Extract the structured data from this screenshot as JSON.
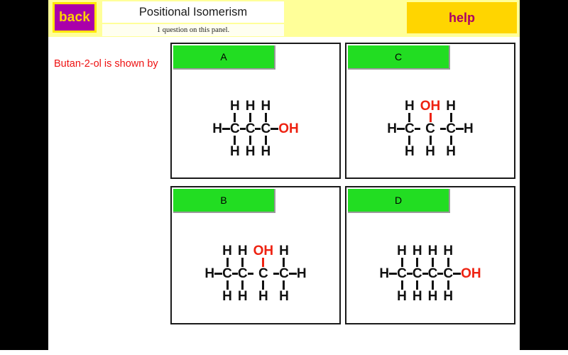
{
  "header": {
    "back_label": "back",
    "title": "Positional Isomerism",
    "subtitle": "1 question on this panel.",
    "help_label": "help",
    "strip_color": "#ffff99",
    "back_color": "#aa00aa",
    "help_color": "#ffd500"
  },
  "question": {
    "prompt": "Butan-2-ol is shown by",
    "prompt_color": "#ee1111"
  },
  "options": [
    {
      "id": "A",
      "label": "A",
      "label_color": "#22dd22",
      "structure": {
        "name": "propan-1-ol",
        "left_terminal": "H",
        "carbons": 3,
        "top_atoms": [
          "H",
          "H",
          "H"
        ],
        "bottom_atoms": [
          "H",
          "H",
          "H"
        ],
        "right_terminal": "OH",
        "right_terminal_color": "#ee2211",
        "hydroxyl_position": "right-terminal"
      }
    },
    {
      "id": "C",
      "label": "C",
      "label_color": "#22dd22",
      "structure": {
        "name": "propan-2-ol",
        "left_terminal": "H",
        "carbons": 3,
        "top_atoms": [
          "H",
          "OH",
          "H"
        ],
        "bottom_atoms": [
          "H",
          "H",
          "H"
        ],
        "right_terminal": "H",
        "right_terminal_color": "#111111",
        "hydroxyl_position": "carbon-2-top"
      }
    },
    {
      "id": "B",
      "label": "B",
      "label_color": "#22dd22",
      "structure": {
        "name": "butan-2-ol",
        "left_terminal": "H",
        "carbons": 4,
        "top_atoms": [
          "H",
          "H",
          "OH",
          "H"
        ],
        "bottom_atoms": [
          "H",
          "H",
          "H",
          "H"
        ],
        "right_terminal": "H",
        "right_terminal_color": "#111111",
        "hydroxyl_position": "carbon-3-top"
      }
    },
    {
      "id": "D",
      "label": "D",
      "label_color": "#22dd22",
      "structure": {
        "name": "butan-1-ol",
        "left_terminal": "H",
        "carbons": 4,
        "top_atoms": [
          "H",
          "H",
          "H",
          "H"
        ],
        "bottom_atoms": [
          "H",
          "H",
          "H",
          "H"
        ],
        "right_terminal": "OH",
        "right_terminal_color": "#ee2211",
        "hydroxyl_position": "right-terminal"
      }
    }
  ]
}
